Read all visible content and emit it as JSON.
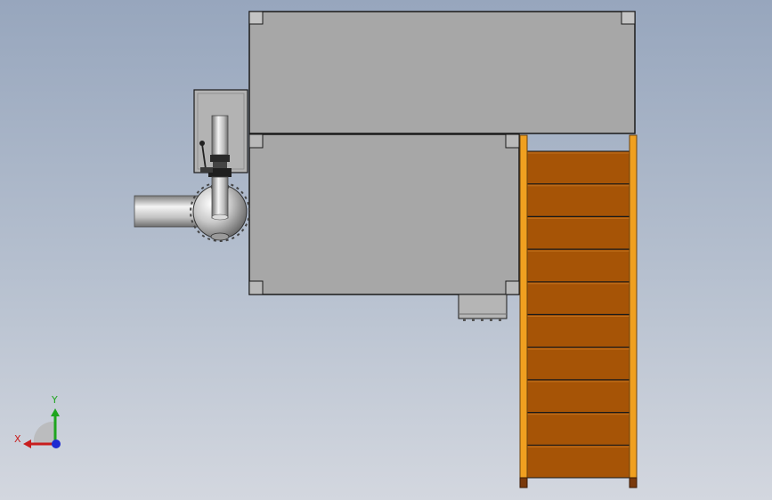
{
  "triad": {
    "x_label": "X",
    "y_label": "Y",
    "x_color": "#c81e1e",
    "y_color": "#1ea51e",
    "z_color": "#1e2ad2"
  },
  "colors": {
    "housing": "#a7a7a7",
    "housing_edge": "#1a1a1a",
    "stair_rail": "#f0a020",
    "stair_tread": "#a65406",
    "pipe_light": "#f2f2f2",
    "pipe_dark": "#7a7a7a"
  },
  "stairs": {
    "tread_count": 10
  }
}
